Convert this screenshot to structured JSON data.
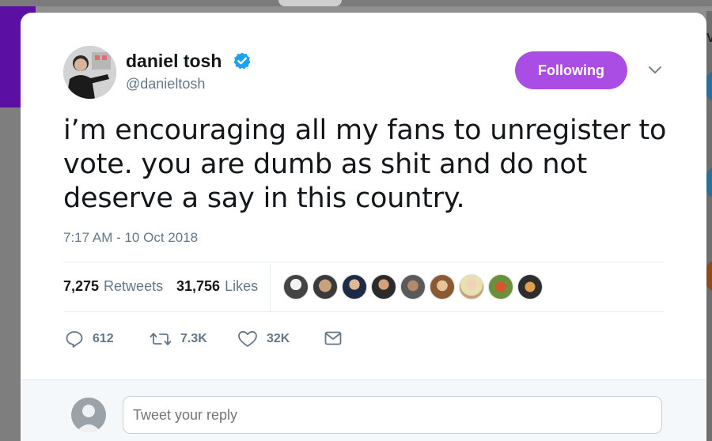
{
  "tweet": {
    "author_name": "daniel tosh",
    "author_handle": "@danieltosh",
    "follow_label": "Following",
    "text": "i’m encouraging all my fans to unregister to vote. you are dumb as shit and do not deserve a say in this country.",
    "timestamp": "7:17 AM - 10 Oct 2018"
  },
  "stats": {
    "retweets_count": "7,275",
    "retweets_label": "Retweets",
    "likes_count": "31,756",
    "likes_label": "Likes"
  },
  "actions": {
    "replies": "612",
    "retweets": "7.3K",
    "likes": "32K"
  },
  "reply": {
    "placeholder": "Tweet your reply"
  },
  "colors": {
    "following_button": "#a94de4",
    "verified_badge": "#1da1f2",
    "secondary_text": "#657786"
  },
  "icons": [
    "verified-badge-icon",
    "chevron-down-icon",
    "reply-icon",
    "retweet-icon",
    "like-icon",
    "direct-message-icon"
  ]
}
